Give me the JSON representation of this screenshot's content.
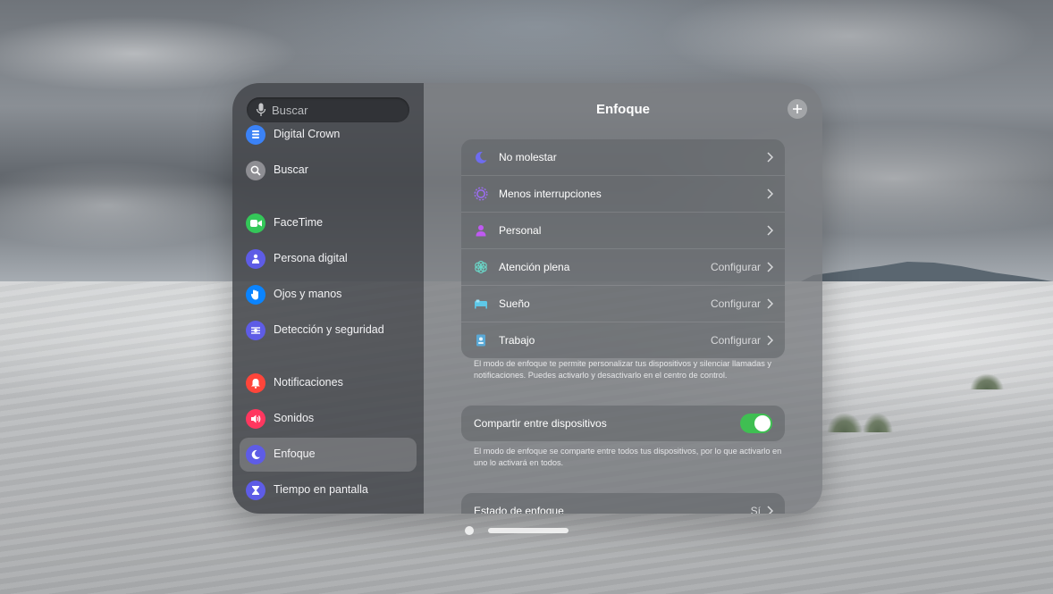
{
  "search": {
    "placeholder": "Buscar"
  },
  "sidebar": {
    "items": [
      {
        "label": "Digital Crown",
        "icon": "digital-crown-icon",
        "color": "#3b82f6"
      },
      {
        "label": "Buscar",
        "icon": "search-icon",
        "color": "#8e8e93"
      },
      {
        "label": "FaceTime",
        "icon": "facetime-icon",
        "color": "#34c759"
      },
      {
        "label": "Persona digital",
        "icon": "persona-icon",
        "color": "#5e5ce6"
      },
      {
        "label": "Ojos y manos",
        "icon": "hand-icon",
        "color": "#0a84ff"
      },
      {
        "label": "Detección y seguridad",
        "icon": "safety-icon",
        "color": "#5e5ce6"
      },
      {
        "label": "Notificaciones",
        "icon": "bell-icon",
        "color": "#ff453a"
      },
      {
        "label": "Sonidos",
        "icon": "speaker-icon",
        "color": "#ff375f"
      },
      {
        "label": "Enfoque",
        "icon": "moon-icon",
        "color": "#5e5ce6",
        "selected": true
      },
      {
        "label": "Tiempo en pantalla",
        "icon": "hourglass-icon",
        "color": "#5e5ce6"
      }
    ]
  },
  "main": {
    "title": "Enfoque",
    "modes": [
      {
        "label": "No molestar",
        "value": "",
        "icon": "moon-icon",
        "color": "#5e5ce6"
      },
      {
        "label": "Menos interrupciones",
        "value": "",
        "icon": "reduce-interruptions-icon",
        "color": "#8e5ce6"
      },
      {
        "label": "Personal",
        "value": "",
        "icon": "person-icon",
        "color": "#bf5af2"
      },
      {
        "label": "Atención plena",
        "value": "Configurar",
        "icon": "mindfulness-icon",
        "color": "#6ad6c8"
      },
      {
        "label": "Sueño",
        "value": "Configurar",
        "icon": "bed-icon",
        "color": "#63d2ff"
      },
      {
        "label": "Trabajo",
        "value": "Configurar",
        "icon": "badge-icon",
        "color": "#64d2ff"
      }
    ],
    "modes_note": "El modo de enfoque te permite personalizar tus dispositivos y silenciar llamadas y notificaciones. Puedes activarlo y desactivarlo en el centro de control.",
    "share": {
      "label": "Compartir entre dispositivos",
      "on": true
    },
    "share_note": "El modo de enfoque se comparte entre todos tus dispositivos, por lo que activarlo en uno lo activará en todos.",
    "status": {
      "label": "Estado de enfoque",
      "value": "Sí"
    }
  },
  "colors": {
    "toggle_on": "#3fbf52"
  }
}
